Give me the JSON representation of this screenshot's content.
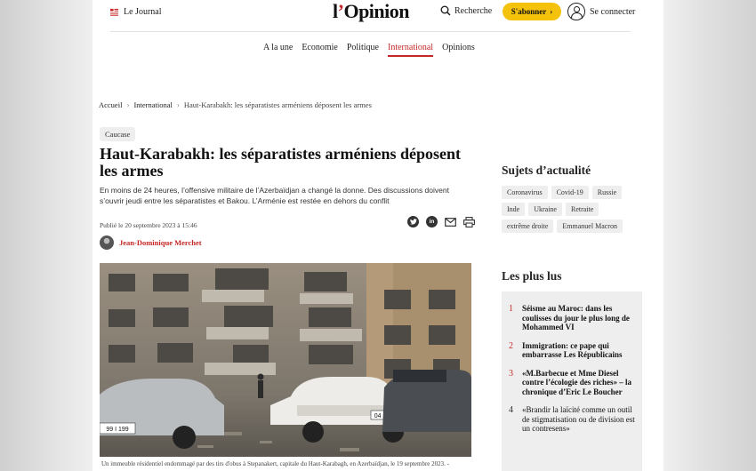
{
  "header": {
    "journal_label": "Le Journal",
    "logo": {
      "part1": "l",
      "apos": "’",
      "part2": "Opinion"
    },
    "search_label": "Recherche",
    "subscribe_label": "S'abonner",
    "connect_label": "Se connecter"
  },
  "nav": [
    {
      "label": "A la une",
      "active": false
    },
    {
      "label": "Economie",
      "active": false
    },
    {
      "label": "Politique",
      "active": false
    },
    {
      "label": "International",
      "active": true
    },
    {
      "label": "Opinions",
      "active": false
    }
  ],
  "breadcrumb": {
    "home": "Accueil",
    "section": "International",
    "current": "Haut-Karabakh: les séparatistes arméniens déposent les armes"
  },
  "article": {
    "tag": "Caucase",
    "title": "Haut-Karabakh: les séparatistes arméniens déposent les armes",
    "lede": "En moins de 24 heures, l’offensive militaire de l’Azerbaïdjan a changé la donne. Des discussions doivent s’ouvrir jeudi entre les séparatistes et Bakou. L’Arménie est restée en dehors du conflit",
    "published": "Publié le 20 septembre 2023 à 15:46",
    "author": "Jean-Dominique Merchet",
    "caption": "Un immeuble résidentiel endommagé par des tirs d'obus à Stepanakert, capitale du Haut-Karabagh, en Azerbaïdjan, le 19 septembre 2023. -",
    "plates": {
      "left": "99 I 199",
      "center": "04 LH 90"
    }
  },
  "share_icons": [
    "twitter-icon",
    "linkedin-icon",
    "mail-icon",
    "print-icon"
  ],
  "sidebar": {
    "topics_title": "Sujets d’actualité",
    "topics": [
      "Coronavirus",
      "Covid-19",
      "Russie",
      "Inde",
      "Ukraine",
      "Retraite",
      "extrême droite",
      "Emmanuel Macron"
    ],
    "popular_title": "Les plus lus",
    "popular": [
      {
        "num": "1",
        "text": "Séisme au Maroc: dans les coulisses du jour le plus long de Mohammed VI",
        "bold": true,
        "red": true
      },
      {
        "num": "2",
        "text": "Immigration: ce pape qui embarrasse Les Républicains",
        "bold": true,
        "red": true
      },
      {
        "num": "3",
        "text": "«M.Barbecue et Mme Diesel contre l’écologie des riches» – la chronique d’Eric Le Boucher",
        "bold": true,
        "red": true
      },
      {
        "num": "4",
        "text": "«Brandir la laïcité comme un outil de stigmatisation ou de division est un contresens»",
        "bold": false,
        "red": false
      }
    ]
  },
  "colors": {
    "accent": "#c62828",
    "subscribe": "#f5c20b"
  }
}
